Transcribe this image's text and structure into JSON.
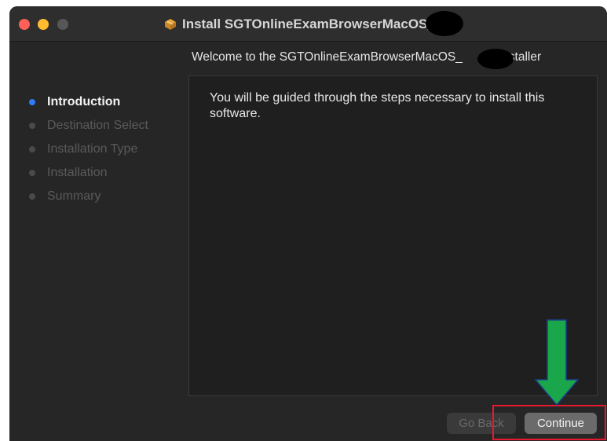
{
  "window": {
    "title": "Install SGTOnlineExamBrowserMacOS_",
    "welcome_prefix": "Welcome to the SGTOnlineExamBrowserMacOS_",
    "welcome_suffix": "Installer"
  },
  "sidebar": {
    "steps": [
      {
        "label": "Introduction",
        "active": true
      },
      {
        "label": "Destination Select",
        "active": false
      },
      {
        "label": "Installation Type",
        "active": false
      },
      {
        "label": "Installation",
        "active": false
      },
      {
        "label": "Summary",
        "active": false
      }
    ]
  },
  "content": {
    "text": "You will be guided through the steps necessary to install this software."
  },
  "buttons": {
    "go_back": "Go Back",
    "continue": "Continue"
  },
  "annotations": {
    "arrow_color": "#1aa64a",
    "highlight_color": "#e8182f"
  },
  "icons": {
    "title_icon": "package-icon"
  }
}
